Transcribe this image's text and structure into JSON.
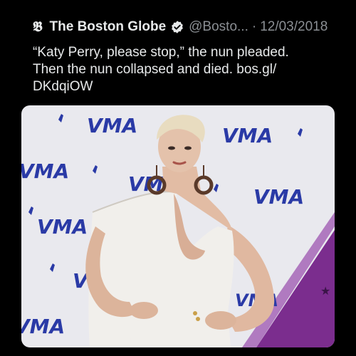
{
  "tweet": {
    "logo_glyph": "𝕭",
    "display_name": "The Boston Globe",
    "verified_icon": "verified-badge-icon",
    "handle": "@Bosto...",
    "separator": "·",
    "date": "12/03/2018",
    "body_lines": [
      "“Katy Perry, please stop,” the nun pleaded.",
      "Then the nun collapsed and died. bos.gl/",
      "DKdqiOW"
    ],
    "media": {
      "backdrop_text": "VMA",
      "colors": {
        "backdrop": "#e9e9ee",
        "logo_blue": "#2a3aa6",
        "purple": "#7b2d8e",
        "dress": "#f1efeb",
        "hair": "#e8dcc0",
        "skin": "#e0b8a0"
      }
    }
  }
}
